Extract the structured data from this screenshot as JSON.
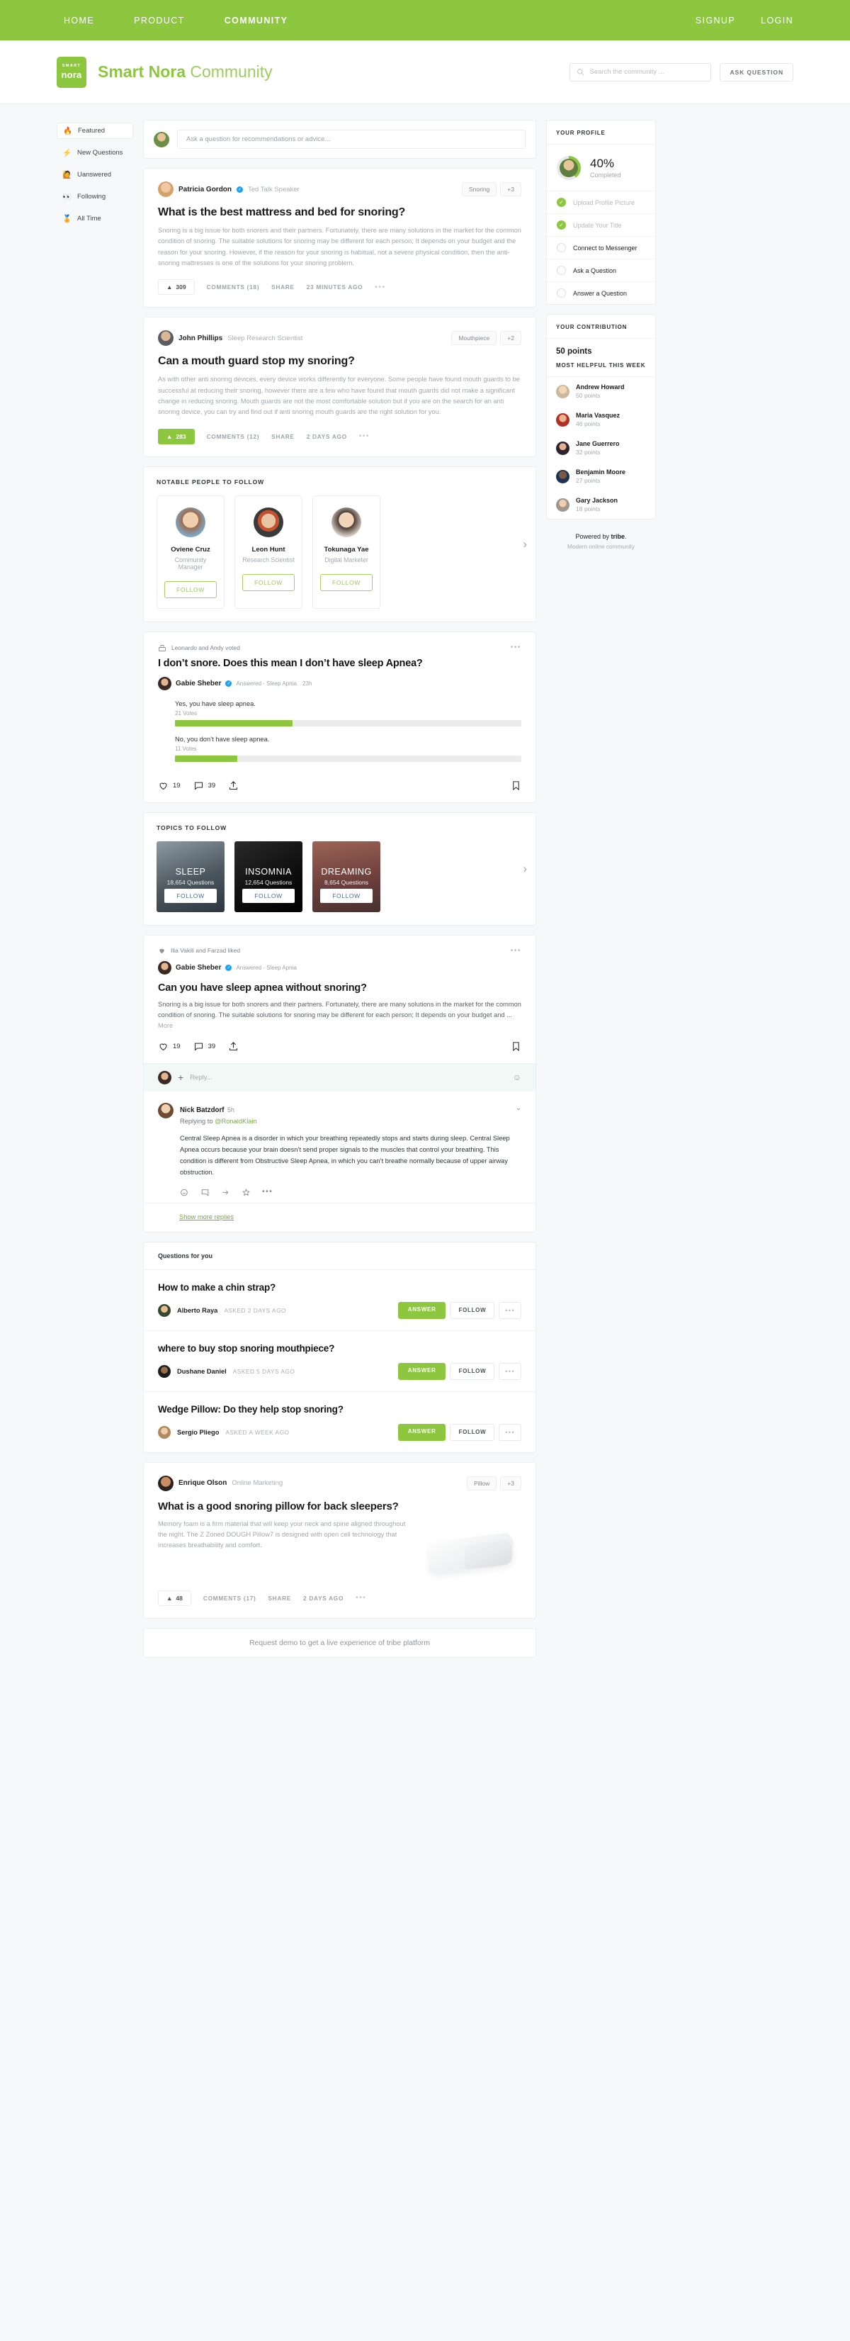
{
  "topnav": {
    "left": [
      {
        "label": "HOME",
        "active": false
      },
      {
        "label": "PRODUCT",
        "active": false
      },
      {
        "label": "COMMUNITY",
        "active": true
      }
    ],
    "right": [
      {
        "label": "SIGNUP"
      },
      {
        "label": "LOGIN"
      }
    ]
  },
  "brand": {
    "logo_line1": "SMART",
    "logo_line2": "nora",
    "name_bold": "Smart Nora",
    "name_light": "Community",
    "search_placeholder": "Search the community ...",
    "ask_button": "ASK QUESTION"
  },
  "sidebar": {
    "items": [
      {
        "icon": "🔥",
        "label": "Featured",
        "selected": true
      },
      {
        "icon": "⚡",
        "label": "New Questions",
        "selected": false
      },
      {
        "icon": "🙋",
        "label": "Uanswered",
        "selected": false
      },
      {
        "icon": "👀",
        "label": "Following",
        "selected": false
      },
      {
        "icon": "🏅",
        "label": "All Time",
        "selected": false
      }
    ]
  },
  "ask_bar": {
    "placeholder": "Ask a question for recommendations or advice..."
  },
  "posts": [
    {
      "author": "Patricia Gordon",
      "verified": true,
      "job": "Ted Talk Speaker",
      "tags": [
        "Snoring",
        "+3"
      ],
      "title": "What is the best mattress and bed for snoring?",
      "body": "Snoring is a big issue for both snorers and their partners. Fortunately, there are many solutions in the market for the common condition of snoring. The suitable solutions for snoring may be different for each person; It depends on your budget and the reason for your snoring. However, if the reason for your snoring is habitual, not a severe physical condition, then the anti-snoring mattresses is one of the solutions for your snoring problem.",
      "votes": "309",
      "comments": "COMMENTS (18)",
      "share": "SHARE",
      "time": "23 MINUTES AGO",
      "voted": false
    },
    {
      "author": "John Phillips",
      "verified": false,
      "job": "Sleep Research Scientist",
      "tags": [
        "Mouthpiece",
        "+2"
      ],
      "title": "Can a mouth guard stop my snoring?",
      "body": "As with other anti snoring devices, every device works differently for everyone. Some people have found mouth guards to be successful at reducing their snoring, however there are a few who have found that mouth guards did not make a significant change in reducing snoring. Mouth guards are not the most comfortable solution but if you are on the search for an anti snoring device, you can try and find out if anti snoring mouth guards are the right solution for you.",
      "votes": "283",
      "comments": "COMMENTS (12)",
      "share": "SHARE",
      "time": "2 DAYS AGO",
      "voted": true
    }
  ],
  "people_section": {
    "title": "NOTABLE PEOPLE TO FOLLOW",
    "follow_label": "FOLLOW",
    "people": [
      {
        "name": "Oviene Cruz",
        "job": "Community Manager"
      },
      {
        "name": "Leon Hunt",
        "job": "Research Scientist"
      },
      {
        "name": "Tokunaga Yae",
        "job": "Digital Marketer"
      }
    ]
  },
  "poll_post": {
    "voted_by": "Leonardo and Andy voted",
    "title": "I don’t snore. Does this mean I don’t have sleep Apnea?",
    "author": "Gabie Sheber",
    "verified": true,
    "answered": "Answered - Sleep Apnia.",
    "time": "23h",
    "options": [
      {
        "label": "Yes, you have sleep apnea.",
        "votes_label": "21 Votes",
        "votes": 21,
        "pct": 34
      },
      {
        "label": "No, you don’t have sleep apnea.",
        "votes_label": "11 Votes",
        "votes": 11,
        "pct": 18
      }
    ],
    "likes": "19",
    "comments": "39"
  },
  "topics_section": {
    "title": "TOPICS TO FOLLOW",
    "follow_label": "FOLLOW",
    "topics": [
      {
        "name": "SLEEP",
        "questions": "18,654 Questions",
        "c1": "#6d7b86",
        "c2": "#3d4850"
      },
      {
        "name": "INSOMNIA",
        "questions": "12,654 Questions",
        "c1": "#1a1a1a",
        "c2": "#0c0c0c"
      },
      {
        "name": "DREAMING",
        "questions": "8,654 Questions",
        "c1": "#8a5448",
        "c2": "#5d3a38"
      }
    ]
  },
  "apnea_post": {
    "liked_by": "Ilia Vakili and Farzad liked",
    "author": "Gabie Sheber",
    "verified": true,
    "answered": "Answered - Sleep Apnia",
    "title": "Can you have sleep apnea without snoring?",
    "body": "Snoring is a big issue for both snorers and their partners. Fortunately, there are many solutions in the market for the common condition of snoring. The suitable solutions for snoring may be different for each person; It depends on your budget and ...",
    "more": "More",
    "likes": "19",
    "comments": "39",
    "reply_placeholder": "Reply..."
  },
  "comment": {
    "author": "Nick Batzdorf",
    "time": "5h",
    "replying_prefix": "Replying to ",
    "replying_to": "@RonaldKlain",
    "body": "Central Sleep Apnea is a disorder in which your breathing repeatedly stops and starts during sleep. Central Sleep Apnea occurs because your brain doesn’t send proper signals to the muscles that control your breathing. This condition is different from Obstructive Sleep Apnea, in which you can’t breathe normally because of upper airway obstruction.",
    "show_more": "Show more replies"
  },
  "questions_for_you": {
    "title": "Questions for you",
    "answer_label": "ANSWER",
    "follow_label": "FOLLOW",
    "rows": [
      {
        "title": "How to make a chin strap?",
        "author": "Alberto Raya",
        "asked": "ASKED 2 DAYS AGO"
      },
      {
        "title": "where to buy stop snoring mouthpiece?",
        "author": "Dushane Daniel",
        "asked": "ASKED 5 DAYS AGO"
      },
      {
        "title": "Wedge Pillow: Do they help stop snoring?",
        "author": "Sergio Pliego",
        "asked": "ASKED A WEEK AGO"
      }
    ]
  },
  "pillow_post": {
    "author": "Enrique Olson",
    "job": "Online Marketing",
    "tags": [
      "Pillow",
      "+3"
    ],
    "title": "What is a good snoring pillow for back sleepers?",
    "body": "Memory foam is a firm material that will keep your neck and spine aligned throughout the night. The Z Zoned DOUGH Pillow7 is designed with open cell technology that increases breathability and comfort.",
    "votes": "48",
    "comments": "COMMENTS (17)",
    "share": "SHARE",
    "time": "2 DAYS AGO"
  },
  "demo_banner": {
    "text": "Request demo to get a live experience of tribe platform"
  },
  "profile": {
    "title": "YOUR PROFILE",
    "percent": "40%",
    "completed": "Completed",
    "tasks": [
      {
        "label": "Upload Profile Picture",
        "done": true
      },
      {
        "label": "Update Your Title",
        "done": true
      },
      {
        "label": "Connect to Messenger",
        "done": false
      },
      {
        "label": "Ask a Question",
        "done": false
      },
      {
        "label": "Answer a Question",
        "done": false
      }
    ]
  },
  "contribution": {
    "title": "YOUR CONTRIBUTION",
    "points": "50 points",
    "most_helpful_title": "MOST HELPFUL THIS WEEK",
    "people": [
      {
        "name": "Andrew Howard",
        "points": "50 points"
      },
      {
        "name": "Maria Vasquez",
        "points": "46 points"
      },
      {
        "name": "Jane Guerrero",
        "points": "32 points"
      },
      {
        "name": "Benjamin Moore",
        "points": "27 points"
      },
      {
        "name": "Gary Jackson",
        "points": "18 points"
      }
    ]
  },
  "tribe": {
    "line1_a": "Powered by ",
    "line1_b": "tribe",
    "line1_c": ".",
    "line2": "Modern online community"
  },
  "colors": {
    "brand_green": "#8dc63f",
    "verified_blue": "#1da1f2"
  }
}
